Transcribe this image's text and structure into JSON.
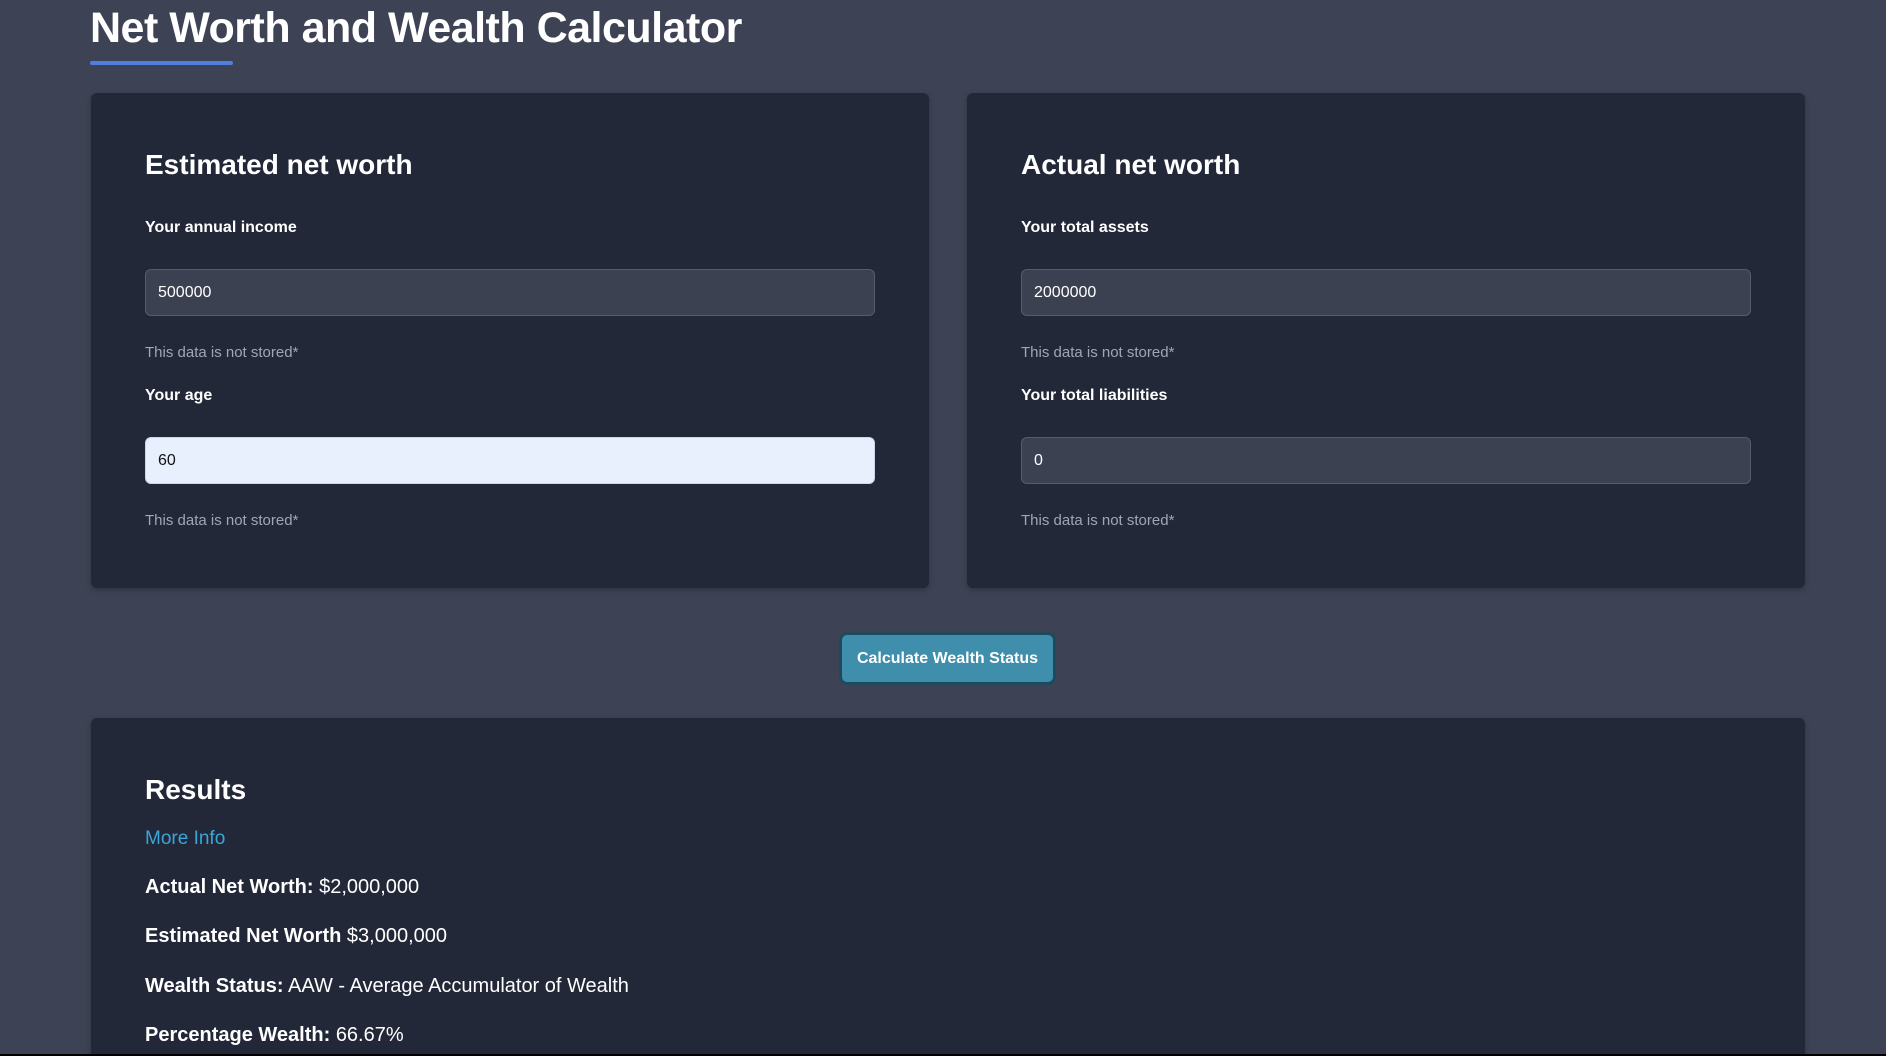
{
  "page": {
    "title": "Net Worth and Wealth Calculator"
  },
  "estimated": {
    "heading": "Estimated net worth",
    "income_label": "Your annual income",
    "income_value": "500000",
    "income_hint": "This data is not stored*",
    "age_label": "Your age",
    "age_value": "60",
    "age_hint": "This data is not stored*"
  },
  "actual": {
    "heading": "Actual net worth",
    "assets_label": "Your total assets",
    "assets_value": "2000000",
    "assets_hint": "This data is not stored*",
    "liabilities_label": "Your total liabilities",
    "liabilities_value": "0",
    "liabilities_hint": "This data is not stored*"
  },
  "actions": {
    "calculate_label": "Calculate Wealth Status"
  },
  "results": {
    "heading": "Results",
    "more_info": "More Info",
    "actual_label": "Actual Net Worth:",
    "actual_value": "$2,000,000",
    "estimated_label": "Estimated Net Worth",
    "estimated_value": "$3,000,000",
    "status_label": "Wealth Status:",
    "status_value": "AAW - Average Accumulator of Wealth",
    "percentage_label": "Percentage Wealth:",
    "percentage_value": "66.67%"
  },
  "colors": {
    "page_background": "#3d4354",
    "card_background": "#222838",
    "accent_underline": "#4f7fe0",
    "button": "#3f8eab",
    "link": "#3aa6d8"
  }
}
